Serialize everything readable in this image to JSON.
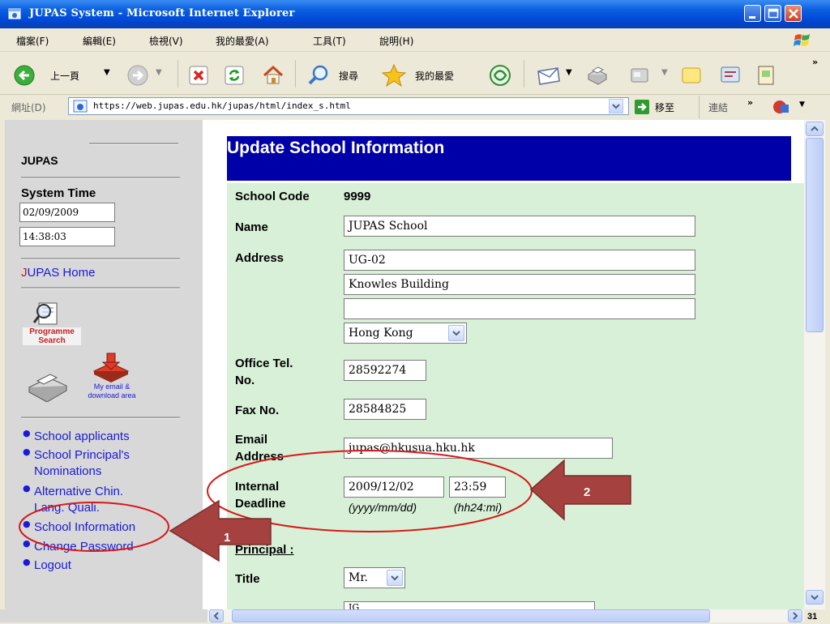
{
  "window": {
    "title": "JUPAS System - Microsoft Internet Explorer"
  },
  "menu": [
    "檔案(F)",
    "編輯(E)",
    "檢視(V)",
    "我的最愛(A)",
    "工具(T)",
    "說明(H)"
  ],
  "toolbar": {
    "back_label": "上一頁",
    "search_label": "搜尋",
    "favorites_label": "我的最愛"
  },
  "address_bar": {
    "label": "網址(D)",
    "url": "https://web.jupas.edu.hk/jupas/html/index_s.html",
    "go_label": "移至",
    "links_label": "連結"
  },
  "sidebar": {
    "site_title": "JUPAS",
    "system_time_label": "System Time",
    "date": "02/09/2009",
    "time": "14:38:03",
    "home_link_initial": "J",
    "home_link_rest": "UPAS Home",
    "programme_search_line1": "Programme",
    "programme_search_line2": "Search",
    "email_area_line1": "My email &",
    "email_area_line2": "download area",
    "nav": [
      {
        "label": "School applicants"
      },
      {
        "label": "School Principal's",
        "label2": "Nominations"
      },
      {
        "label": "Alternative Chin.",
        "label2": "Lang. Quali."
      },
      {
        "label": "School Information"
      },
      {
        "label": "Change Password"
      },
      {
        "label": "Logout"
      }
    ]
  },
  "form": {
    "heading": "Update School Information",
    "school_code_label": "School Code",
    "school_code": "9999",
    "name_label": "Name",
    "name": "JUPAS School",
    "address_label": "Address",
    "address1": "UG-02",
    "address2": "Knowles Building",
    "address3": "",
    "region": "Hong Kong",
    "tel_label_1": "Office Tel.",
    "tel_label_2": "No.",
    "tel": "28592274",
    "fax_label": "Fax No.",
    "fax": "28584825",
    "email_label_1": "Email",
    "email_label_2": "Address",
    "email": "jupas@hkusua.hku.hk",
    "deadline_label_1": "Internal",
    "deadline_label_2": "Deadline",
    "deadline_date": "2009/12/02",
    "deadline_time": "23:59",
    "deadline_date_hint": "(yyyy/mm/dd)",
    "deadline_time_hint": "(hh24:mi)",
    "principal_label": "Principal :",
    "title_label": "Title",
    "title_value": "Mr.",
    "next_field_partial": "IG"
  },
  "annotations": {
    "arrow1_number": "1",
    "arrow2_number": "2",
    "color": "#a5413f",
    "ellipse_color": "#d81818"
  },
  "slide": {
    "page_number": "31"
  }
}
